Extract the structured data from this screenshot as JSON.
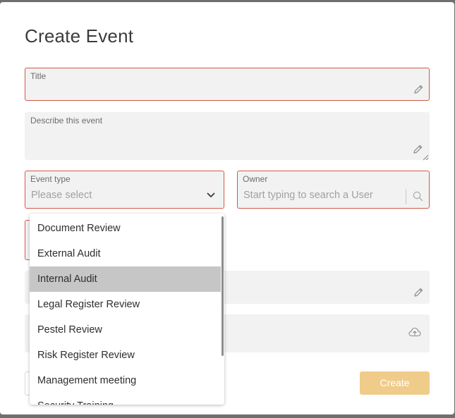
{
  "modal": {
    "title": "Create Event"
  },
  "fields": {
    "title_label": "Title",
    "description_label": "Describe this event",
    "event_type_label": "Event type",
    "event_type_placeholder": "Please select",
    "owner_label": "Owner",
    "owner_placeholder": "Start typing to search a User"
  },
  "dropdown": {
    "options": [
      {
        "label": "Document Review"
      },
      {
        "label": "External Audit"
      },
      {
        "label": "Internal Audit"
      },
      {
        "label": "Legal Register Review"
      },
      {
        "label": "Pestel Review"
      },
      {
        "label": "Risk Register Review"
      },
      {
        "label": "Management meeting"
      },
      {
        "label": "Security Training"
      }
    ],
    "highlighted": "Internal Audit"
  },
  "actions": {
    "create_label": "Create"
  },
  "colors": {
    "error_border": "#cf5a46",
    "field_bg": "#f2f2f2",
    "create_button": "#f0cc8a",
    "highlight": "#c6c6c6"
  },
  "icons": {
    "title_field": "pencil-icon",
    "description_field": "pencil-icon",
    "event_type_field": "chevron-down-icon",
    "owner_field": "search-icon",
    "hidden_field_1": "pencil-icon",
    "upload_field": "cloud-upload-icon"
  }
}
